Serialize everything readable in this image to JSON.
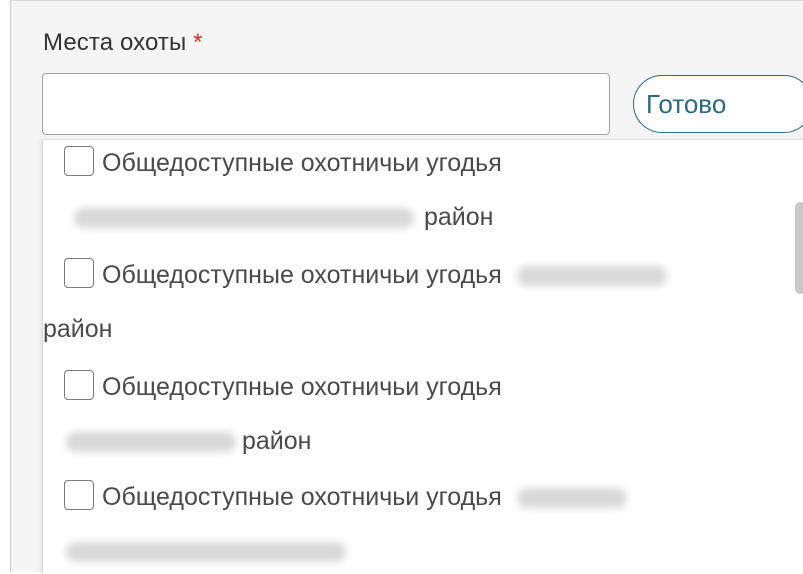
{
  "field": {
    "label": "Места охоты",
    "required_mark": "*",
    "value": "",
    "done_label": "Готово"
  },
  "options": [
    {
      "prefix": "Общедоступные охотничьи угодья",
      "suffix": "район",
      "checked": false
    },
    {
      "prefix": "Общедоступные охотничьи угодья",
      "suffix": "район",
      "checked": false
    },
    {
      "prefix": "Общедоступные охотничьи угодья",
      "suffix": "район",
      "checked": false
    },
    {
      "prefix": "Общедоступные охотничьи угодья",
      "suffix": "",
      "checked": false
    }
  ],
  "colors": {
    "accent": "#2d6a80",
    "required": "#d93025"
  }
}
